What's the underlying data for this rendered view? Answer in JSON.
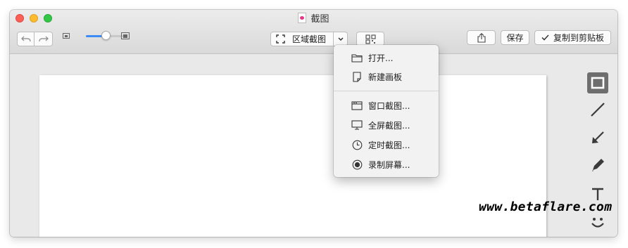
{
  "window": {
    "title": "截图"
  },
  "toolbar": {
    "capture_mode_label": "区域截图",
    "save_label": "保存",
    "copy_label": "复制到剪贴板",
    "zoom_level": 0.5
  },
  "menu": {
    "items": [
      {
        "label": "打开...",
        "icon": "folder-icon"
      },
      {
        "label": "新建画板",
        "icon": "new-document-icon"
      },
      {
        "label": "窗口截图...",
        "icon": "window-capture-icon"
      },
      {
        "label": "全屏截图...",
        "icon": "monitor-icon"
      },
      {
        "label": "定时截图...",
        "icon": "clock-icon"
      },
      {
        "label": "录制屏幕...",
        "icon": "record-icon"
      }
    ]
  },
  "tools": [
    {
      "name": "rectangle-tool",
      "active": true
    },
    {
      "name": "line-tool",
      "active": false
    },
    {
      "name": "arrow-tool",
      "active": false
    },
    {
      "name": "pen-tool",
      "active": false
    },
    {
      "name": "text-tool",
      "active": false
    },
    {
      "name": "emoji-tool",
      "active": false
    }
  ],
  "watermark": {
    "text": "www.betaflare.com"
  },
  "colors": {
    "accent": "#3a8bf5",
    "active_tool": "#6e6e6e"
  }
}
